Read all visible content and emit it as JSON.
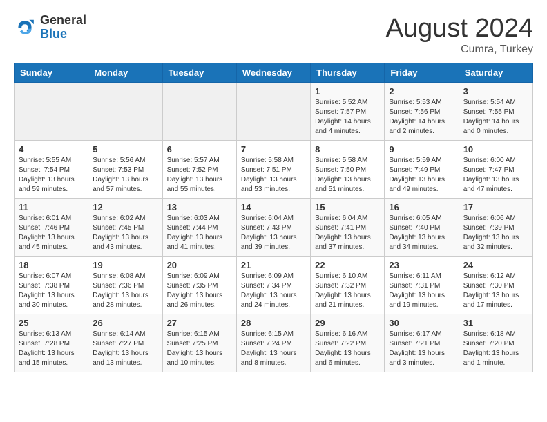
{
  "header": {
    "logo_general": "General",
    "logo_blue": "Blue",
    "month_year": "August 2024",
    "location": "Cumra, Turkey"
  },
  "weekdays": [
    "Sunday",
    "Monday",
    "Tuesday",
    "Wednesday",
    "Thursday",
    "Friday",
    "Saturday"
  ],
  "weeks": [
    [
      {
        "day": "",
        "info": ""
      },
      {
        "day": "",
        "info": ""
      },
      {
        "day": "",
        "info": ""
      },
      {
        "day": "",
        "info": ""
      },
      {
        "day": "1",
        "info": "Sunrise: 5:52 AM\nSunset: 7:57 PM\nDaylight: 14 hours\nand 4 minutes."
      },
      {
        "day": "2",
        "info": "Sunrise: 5:53 AM\nSunset: 7:56 PM\nDaylight: 14 hours\nand 2 minutes."
      },
      {
        "day": "3",
        "info": "Sunrise: 5:54 AM\nSunset: 7:55 PM\nDaylight: 14 hours\nand 0 minutes."
      }
    ],
    [
      {
        "day": "4",
        "info": "Sunrise: 5:55 AM\nSunset: 7:54 PM\nDaylight: 13 hours\nand 59 minutes."
      },
      {
        "day": "5",
        "info": "Sunrise: 5:56 AM\nSunset: 7:53 PM\nDaylight: 13 hours\nand 57 minutes."
      },
      {
        "day": "6",
        "info": "Sunrise: 5:57 AM\nSunset: 7:52 PM\nDaylight: 13 hours\nand 55 minutes."
      },
      {
        "day": "7",
        "info": "Sunrise: 5:58 AM\nSunset: 7:51 PM\nDaylight: 13 hours\nand 53 minutes."
      },
      {
        "day": "8",
        "info": "Sunrise: 5:58 AM\nSunset: 7:50 PM\nDaylight: 13 hours\nand 51 minutes."
      },
      {
        "day": "9",
        "info": "Sunrise: 5:59 AM\nSunset: 7:49 PM\nDaylight: 13 hours\nand 49 minutes."
      },
      {
        "day": "10",
        "info": "Sunrise: 6:00 AM\nSunset: 7:47 PM\nDaylight: 13 hours\nand 47 minutes."
      }
    ],
    [
      {
        "day": "11",
        "info": "Sunrise: 6:01 AM\nSunset: 7:46 PM\nDaylight: 13 hours\nand 45 minutes."
      },
      {
        "day": "12",
        "info": "Sunrise: 6:02 AM\nSunset: 7:45 PM\nDaylight: 13 hours\nand 43 minutes."
      },
      {
        "day": "13",
        "info": "Sunrise: 6:03 AM\nSunset: 7:44 PM\nDaylight: 13 hours\nand 41 minutes."
      },
      {
        "day": "14",
        "info": "Sunrise: 6:04 AM\nSunset: 7:43 PM\nDaylight: 13 hours\nand 39 minutes."
      },
      {
        "day": "15",
        "info": "Sunrise: 6:04 AM\nSunset: 7:41 PM\nDaylight: 13 hours\nand 37 minutes."
      },
      {
        "day": "16",
        "info": "Sunrise: 6:05 AM\nSunset: 7:40 PM\nDaylight: 13 hours\nand 34 minutes."
      },
      {
        "day": "17",
        "info": "Sunrise: 6:06 AM\nSunset: 7:39 PM\nDaylight: 13 hours\nand 32 minutes."
      }
    ],
    [
      {
        "day": "18",
        "info": "Sunrise: 6:07 AM\nSunset: 7:38 PM\nDaylight: 13 hours\nand 30 minutes."
      },
      {
        "day": "19",
        "info": "Sunrise: 6:08 AM\nSunset: 7:36 PM\nDaylight: 13 hours\nand 28 minutes."
      },
      {
        "day": "20",
        "info": "Sunrise: 6:09 AM\nSunset: 7:35 PM\nDaylight: 13 hours\nand 26 minutes."
      },
      {
        "day": "21",
        "info": "Sunrise: 6:09 AM\nSunset: 7:34 PM\nDaylight: 13 hours\nand 24 minutes."
      },
      {
        "day": "22",
        "info": "Sunrise: 6:10 AM\nSunset: 7:32 PM\nDaylight: 13 hours\nand 21 minutes."
      },
      {
        "day": "23",
        "info": "Sunrise: 6:11 AM\nSunset: 7:31 PM\nDaylight: 13 hours\nand 19 minutes."
      },
      {
        "day": "24",
        "info": "Sunrise: 6:12 AM\nSunset: 7:30 PM\nDaylight: 13 hours\nand 17 minutes."
      }
    ],
    [
      {
        "day": "25",
        "info": "Sunrise: 6:13 AM\nSunset: 7:28 PM\nDaylight: 13 hours\nand 15 minutes."
      },
      {
        "day": "26",
        "info": "Sunrise: 6:14 AM\nSunset: 7:27 PM\nDaylight: 13 hours\nand 13 minutes."
      },
      {
        "day": "27",
        "info": "Sunrise: 6:15 AM\nSunset: 7:25 PM\nDaylight: 13 hours\nand 10 minutes."
      },
      {
        "day": "28",
        "info": "Sunrise: 6:15 AM\nSunset: 7:24 PM\nDaylight: 13 hours\nand 8 minutes."
      },
      {
        "day": "29",
        "info": "Sunrise: 6:16 AM\nSunset: 7:22 PM\nDaylight: 13 hours\nand 6 minutes."
      },
      {
        "day": "30",
        "info": "Sunrise: 6:17 AM\nSunset: 7:21 PM\nDaylight: 13 hours\nand 3 minutes."
      },
      {
        "day": "31",
        "info": "Sunrise: 6:18 AM\nSunset: 7:20 PM\nDaylight: 13 hours\nand 1 minute."
      }
    ]
  ]
}
